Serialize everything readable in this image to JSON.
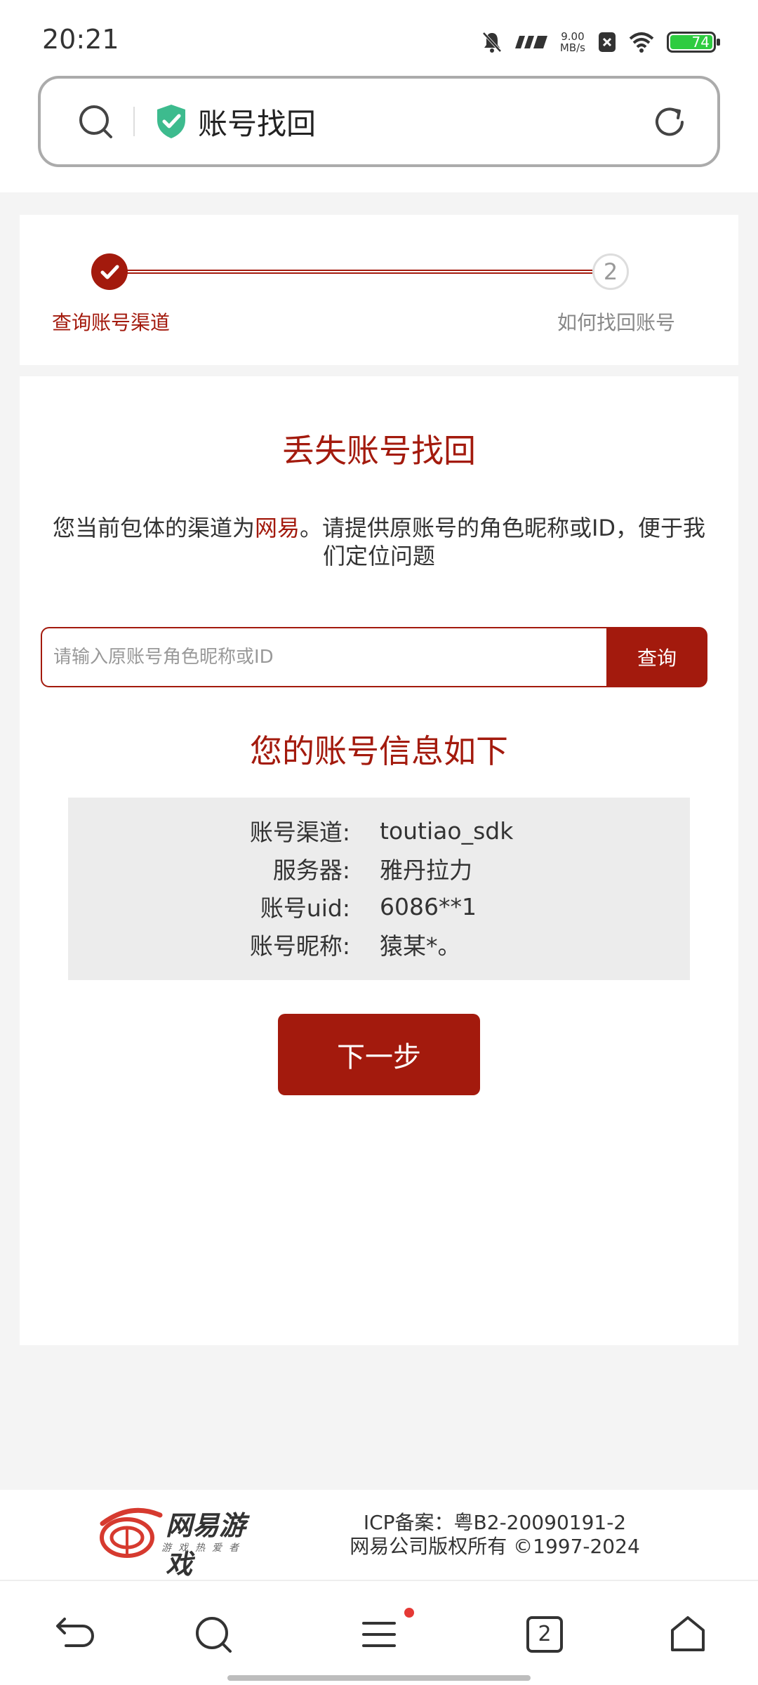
{
  "status_bar": {
    "time": "20:21",
    "net_speed_value": "9.00",
    "net_speed_unit": "MB/s",
    "battery": "74"
  },
  "url_bar": {
    "title": "账号找回"
  },
  "steps": {
    "step1_label": "查询账号渠道",
    "step2_number": "2",
    "step2_label": "如何找回账号"
  },
  "main": {
    "title": "丢失账号找回",
    "desc_prefix": "您当前包体的渠道为",
    "desc_channel": "网易",
    "desc_suffix": "。请提供原账号的角色昵称或ID，便于我们定位问题",
    "search_placeholder": "请输入原账号角色昵称或ID",
    "query_button": "查询",
    "info_title": "您的账号信息如下",
    "info_rows": [
      {
        "key": "账号渠道:",
        "value": "toutiao_sdk"
      },
      {
        "key": "服务器:",
        "value": "雅丹拉力"
      },
      {
        "key": "账号uid:",
        "value": "6086**1"
      },
      {
        "key": "账号昵称:",
        "value": "猿某*。"
      }
    ],
    "next_button": "下一步"
  },
  "footer": {
    "brand": "网易游戏",
    "slogan": "游戏热爱者",
    "icp": "ICP备案：粤B2-20090191-2",
    "copyright": "网易公司版权所有 ©1997-2024"
  },
  "bottom_nav": {
    "tabs_count": "2"
  },
  "colors": {
    "accent": "#a31a0d",
    "info_bg": "#ececec",
    "page_bg": "#f4f4f4"
  }
}
